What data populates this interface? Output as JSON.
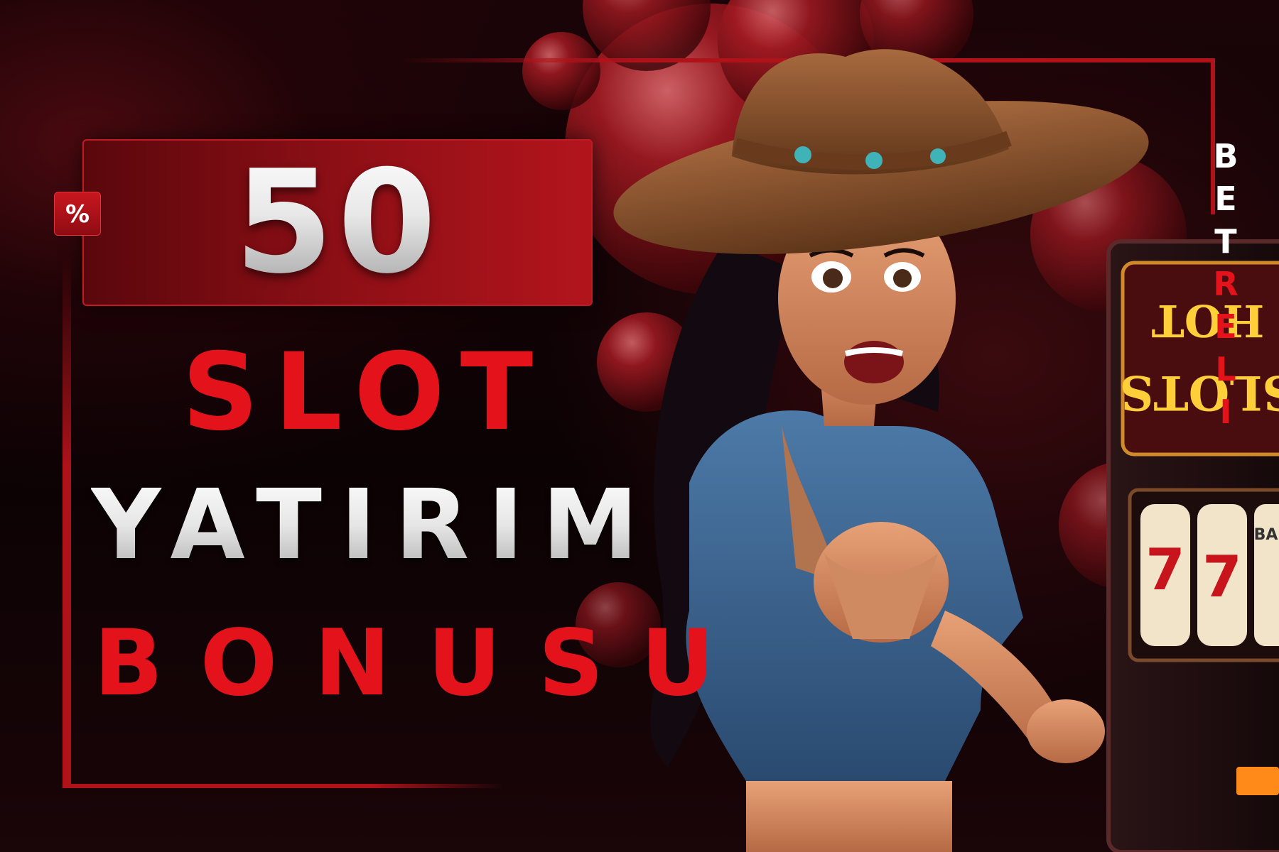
{
  "promo": {
    "percent_symbol": "%",
    "amount": "50",
    "line_1": "SLOT",
    "line_2": "YATIRIM",
    "line_3": "BONUSU"
  },
  "brand": {
    "letters": [
      "B",
      "E",
      "T",
      "R",
      "E",
      "L",
      "I"
    ]
  },
  "slot_machine": {
    "sign_line_1": "HOT",
    "sign_line_2": "SLOTS",
    "reel_symbol": "7",
    "bar_label": "BAR"
  },
  "colors": {
    "accent_red": "#e3121b",
    "panel_red": "#8d0f16",
    "background": "#0a0204"
  },
  "icons": [
    "percent-icon",
    "cowgirl-illustration",
    "slot-machine-icon",
    "bubble-decoration"
  ]
}
